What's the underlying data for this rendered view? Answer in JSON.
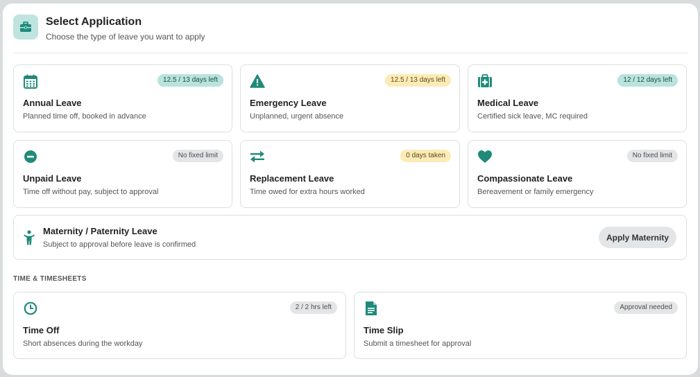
{
  "header": {
    "title": "Select Application",
    "subtitle": "Choose the type of leave you want to apply",
    "icon": "briefcase-icon"
  },
  "colors": {
    "accent": "#1f8a7a",
    "badge_teal": "#b9e3dd",
    "badge_yellow": "#fcebb6",
    "badge_grey": "#e3e5e6"
  },
  "leave_cards": [
    {
      "title": "Annual Leave",
      "desc": "Planned time off, booked in advance",
      "badge": "12.5 / 13 days left",
      "icon": "calendar-icon"
    },
    {
      "title": "Emergency Leave",
      "desc": "Unplanned, urgent absence",
      "badge": "12.5 / 13 days left",
      "icon": "warning-icon"
    },
    {
      "title": "Medical Leave",
      "desc": "Certified sick leave, MC required",
      "badge": "12 / 12 days left",
      "icon": "medical-kit-icon"
    },
    {
      "title": "Unpaid Leave",
      "desc": "Time off without pay, subject to approval",
      "badge": "No fixed limit",
      "icon": "minus-circle-icon"
    },
    {
      "title": "Replacement Leave",
      "desc": "Time owed for extra hours worked",
      "badge": "0 days taken",
      "icon": "swap-arrows-icon"
    },
    {
      "title": "Compassionate Leave",
      "desc": "Bereavement or family emergency",
      "badge": "No fixed limit",
      "icon": "heart-icon"
    }
  ],
  "maternity": {
    "title": "Maternity / Paternity Leave",
    "desc": "Subject to approval before leave is confirmed",
    "button": "Apply Maternity",
    "icon": "child-icon"
  },
  "timesheets": {
    "section_label": "TIME & TIMESHEETS",
    "cards": [
      {
        "title": "Time Off",
        "desc": "Short absences during the workday",
        "badge": "2 / 2 hrs left",
        "icon": "clock-icon"
      },
      {
        "title": "Time Slip",
        "desc": "Submit a timesheet for approval",
        "badge": "Approval needed",
        "icon": "document-icon"
      }
    ]
  }
}
